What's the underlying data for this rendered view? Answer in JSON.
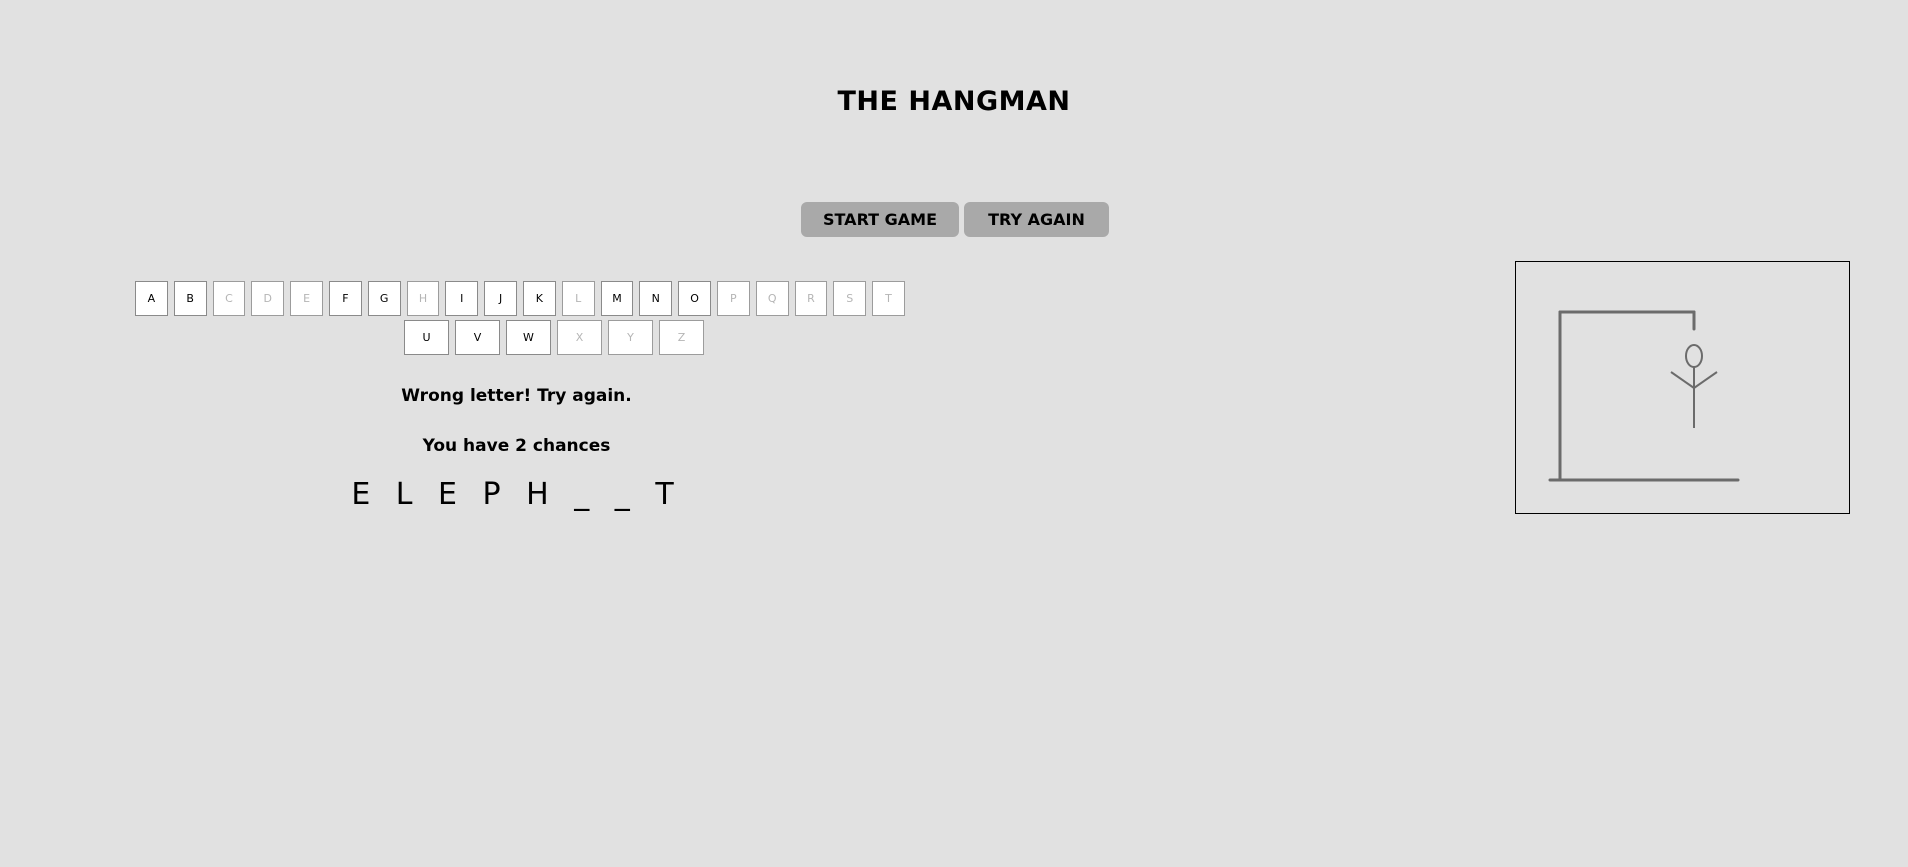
{
  "header": {
    "title": "THE HANGMAN"
  },
  "controls": {
    "start_label": "START GAME",
    "try_again_label": "TRY AGAIN"
  },
  "keyboard": {
    "row1": [
      {
        "letter": "A",
        "disabled": false
      },
      {
        "letter": "B",
        "disabled": false
      },
      {
        "letter": "C",
        "disabled": true
      },
      {
        "letter": "D",
        "disabled": true
      },
      {
        "letter": "E",
        "disabled": true
      },
      {
        "letter": "F",
        "disabled": false
      },
      {
        "letter": "G",
        "disabled": false
      },
      {
        "letter": "H",
        "disabled": true
      },
      {
        "letter": "I",
        "disabled": false
      },
      {
        "letter": "J",
        "disabled": false
      },
      {
        "letter": "K",
        "disabled": false
      },
      {
        "letter": "L",
        "disabled": true
      },
      {
        "letter": "M",
        "disabled": false
      },
      {
        "letter": "N",
        "disabled": false
      },
      {
        "letter": "O",
        "disabled": false
      },
      {
        "letter": "P",
        "disabled": true
      },
      {
        "letter": "Q",
        "disabled": true
      },
      {
        "letter": "R",
        "disabled": true
      },
      {
        "letter": "S",
        "disabled": true
      },
      {
        "letter": "T",
        "disabled": true
      }
    ],
    "row2": [
      {
        "letter": "U",
        "disabled": false
      },
      {
        "letter": "V",
        "disabled": false
      },
      {
        "letter": "W",
        "disabled": false
      },
      {
        "letter": "X",
        "disabled": true
      },
      {
        "letter": "Y",
        "disabled": true
      },
      {
        "letter": "Z",
        "disabled": true
      }
    ]
  },
  "status": {
    "message": "Wrong letter! Try again.",
    "chances": "You have 2 chances",
    "word_display": "E L E P H _ _ T"
  },
  "colors": {
    "background": "#e1e1e1",
    "button": "#a9a9a9",
    "drawing_stroke": "#6b6b6b"
  }
}
